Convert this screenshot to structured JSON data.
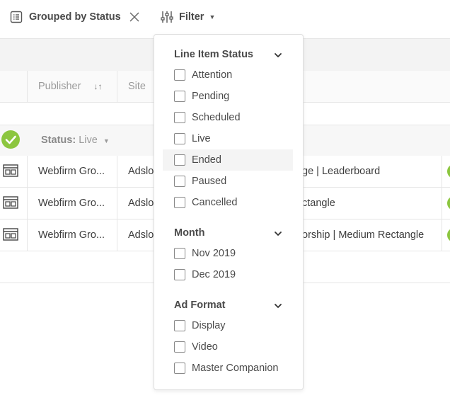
{
  "toolbar": {
    "group_chip_label": "Grouped by Status",
    "filter_label": "Filter"
  },
  "table": {
    "columns": {
      "publisher": "Publisher",
      "site": "Site"
    },
    "group": {
      "label": "Status:",
      "value": "Live"
    },
    "rows": [
      {
        "publisher": "Webfirm Gro...",
        "site": "Adslo",
        "name": "ge | Leaderboard"
      },
      {
        "publisher": "Webfirm Gro...",
        "site": "Adslo",
        "name": "ctangle"
      },
      {
        "publisher": "Webfirm Gro...",
        "site": "Adslo",
        "name": "orship | Medium Rectangle"
      }
    ]
  },
  "filter_panel": {
    "sections": [
      {
        "title": "Line Item Status",
        "options": [
          "Attention",
          "Pending",
          "Scheduled",
          "Live",
          "Ended",
          "Paused",
          "Cancelled"
        ]
      },
      {
        "title": "Month",
        "options": [
          "Nov 2019",
          "Dec 2019"
        ]
      },
      {
        "title": "Ad Format",
        "options": [
          "Display",
          "Video",
          "Master Companion"
        ]
      }
    ]
  },
  "colors": {
    "status_live": "#8cc63f",
    "accent_text": "#4a4a4a"
  }
}
